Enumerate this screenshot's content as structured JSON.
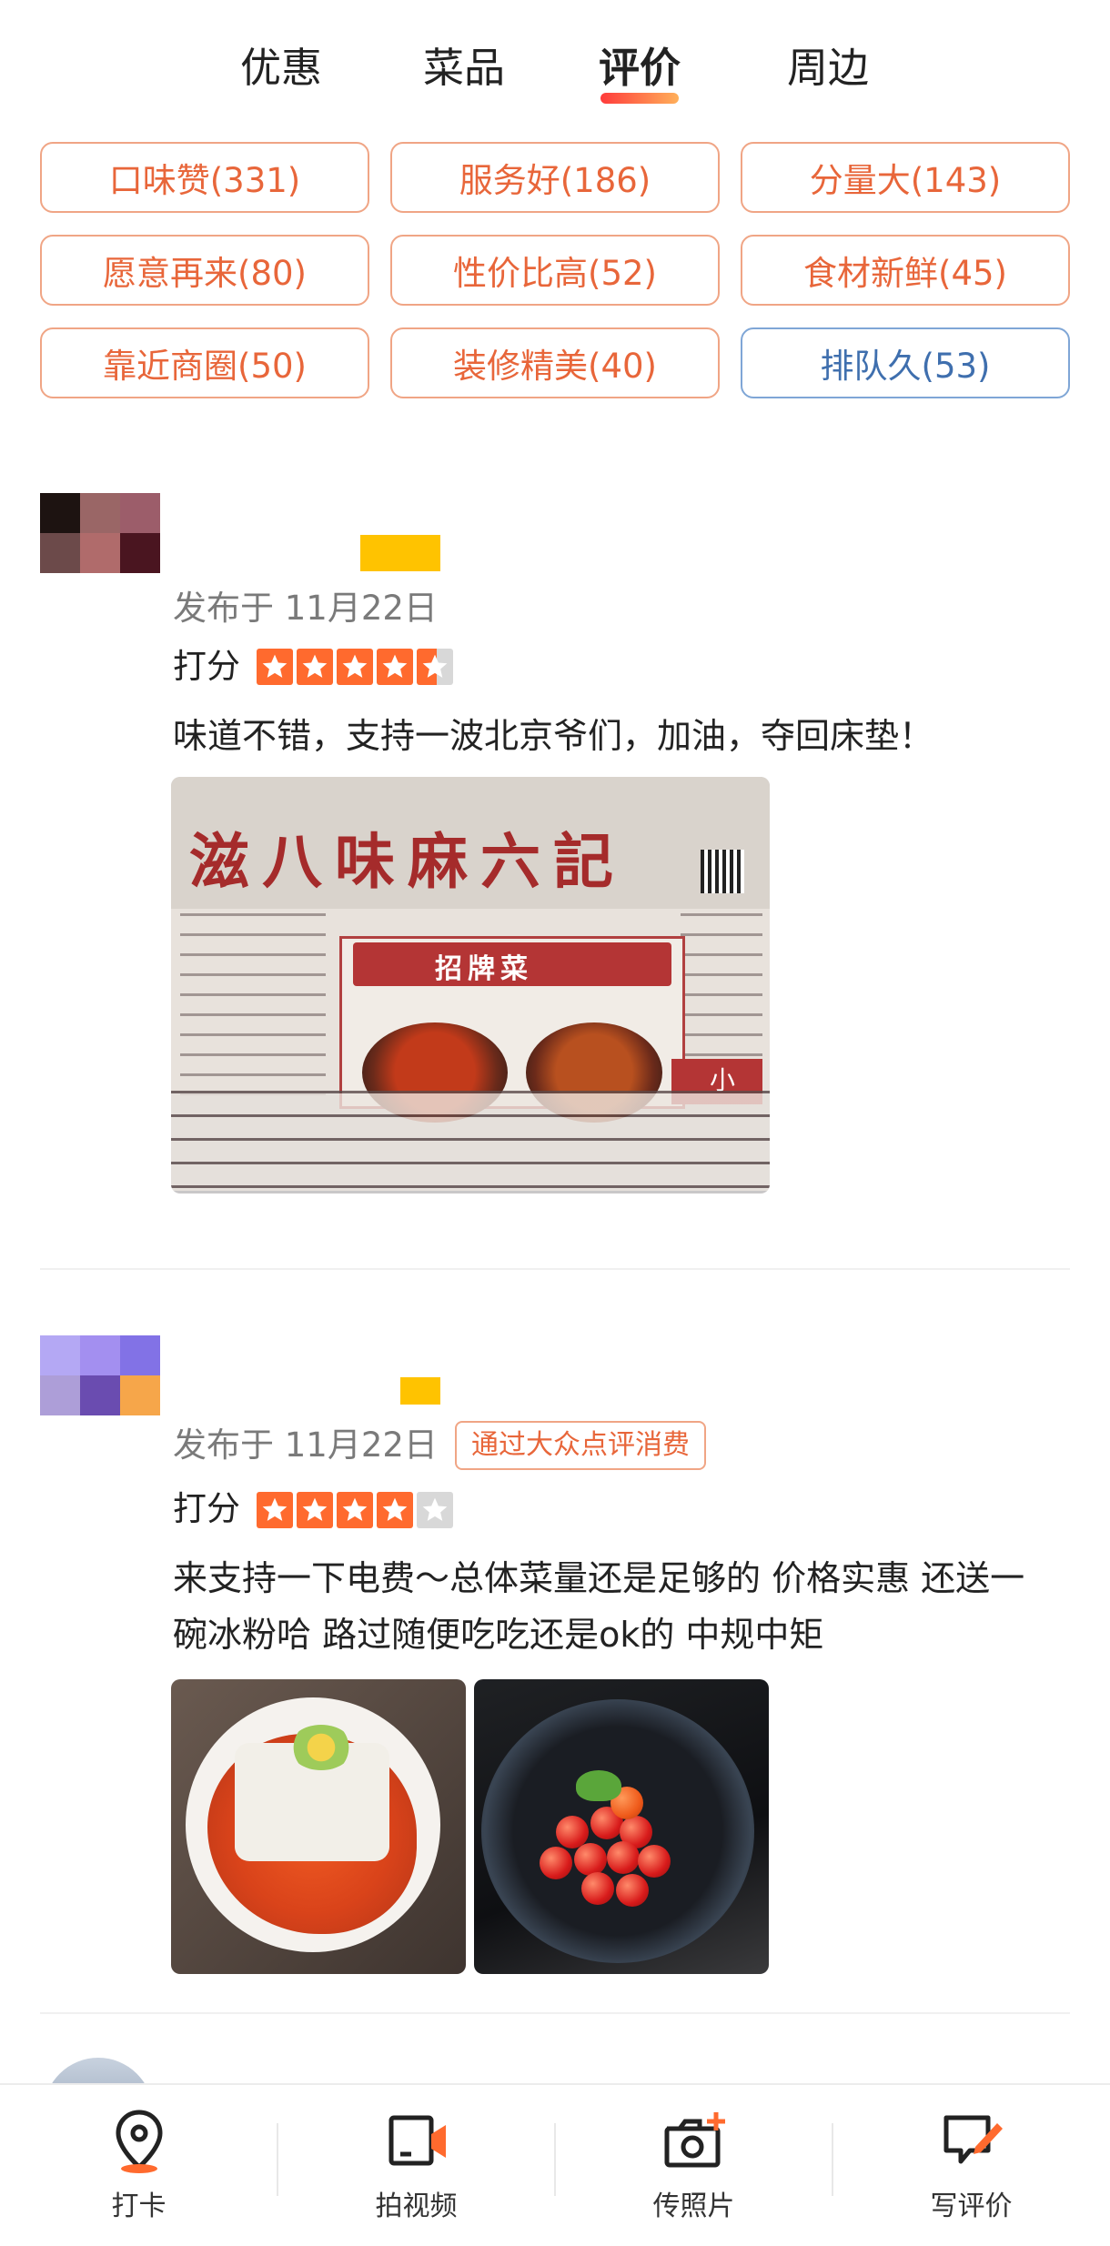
{
  "tabs": [
    {
      "label": "优惠",
      "active": false
    },
    {
      "label": "菜品",
      "active": false
    },
    {
      "label": "评价",
      "active": true
    },
    {
      "label": "周边",
      "active": false
    }
  ],
  "tags": [
    {
      "label": "口味赞(331)"
    },
    {
      "label": "服务好(186)"
    },
    {
      "label": "分量大(143)"
    },
    {
      "label": "愿意再来(80)"
    },
    {
      "label": "性价比高(52)"
    },
    {
      "label": "食材新鲜(45)"
    },
    {
      "label": "靠近商圈(50)"
    },
    {
      "label": "装修精美(40)"
    },
    {
      "label": "排队久(53)"
    }
  ],
  "reviews": [
    {
      "date": "发布于 11月22日",
      "score_label": "打分",
      "rating": 4.5,
      "text": "味道不错，支持一波北京爷们，加油，夺回床垫！",
      "photo_text": "滋八味麻六記",
      "photo_banner": "招牌菜",
      "photo_small": "小"
    },
    {
      "date": "发布于 11月22日",
      "badge": "通过大众点评消费",
      "score_label": "打分",
      "rating": 4,
      "text": "来支持一下电费～总体菜量还是足够的 价格实惠 还送一碗冰粉哈 路过随便吃吃还是ok的 中规中矩"
    }
  ],
  "bottom_bar": [
    {
      "label": "打卡",
      "icon": "location-pin-icon"
    },
    {
      "label": "拍视频",
      "icon": "video-camera-icon"
    },
    {
      "label": "传照片",
      "icon": "camera-plus-icon"
    },
    {
      "label": "写评价",
      "icon": "edit-review-icon"
    }
  ],
  "colors": {
    "accent": "#e8663a",
    "star": "#ff6a2e",
    "tag_border": "#f0a585",
    "tag_blue": "#3f6fae"
  }
}
